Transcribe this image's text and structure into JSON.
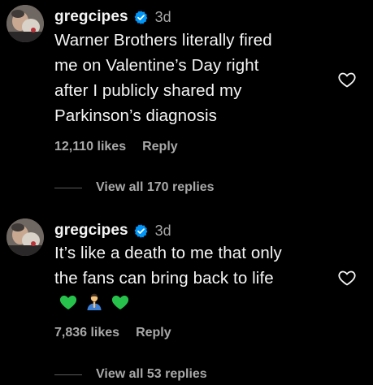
{
  "comments": [
    {
      "username": "gregcipes",
      "time": "3d",
      "text": "Warner Brothers literally fired\nme on Valentine’s Day right\nafter I publicly shared my\nParkinson’s diagnosis",
      "likes": "12,110 likes",
      "reply_label": "Reply",
      "view_replies": "View all 170 replies"
    },
    {
      "username": "gregcipes",
      "time": "3d",
      "text": "It’s like a death to me that only\nthe fans can bring back to life",
      "emojis": [
        "green-heart-icon",
        "person-praying-icon",
        "green-heart-icon"
      ],
      "likes": "7,836 likes",
      "reply_label": "Reply",
      "view_replies": "View all 53 replies"
    }
  ],
  "colors": {
    "background": "#000000",
    "text_primary": "#f5f5f5",
    "text_secondary": "#a8a8a8",
    "verified_badge": "#0095f6",
    "green_heart": "#27c24c"
  }
}
